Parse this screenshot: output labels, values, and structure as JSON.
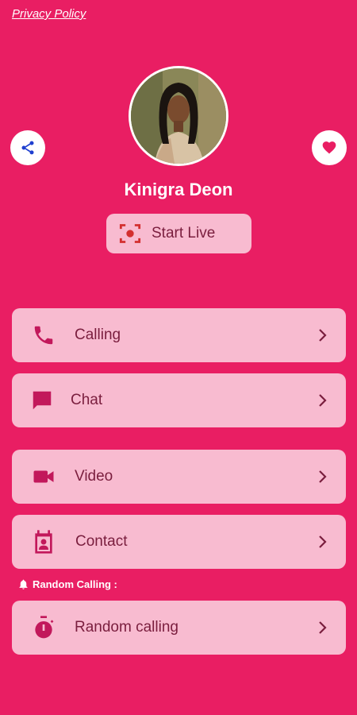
{
  "header": {
    "privacy_link": "Privacy Policy"
  },
  "profile": {
    "name": "Kinigra Deon"
  },
  "live": {
    "label": "Start Live"
  },
  "menu": [
    {
      "label": "Calling",
      "icon": "phone-icon"
    },
    {
      "label": "Chat",
      "icon": "chat-icon"
    },
    {
      "label": "Video",
      "icon": "video-icon"
    },
    {
      "label": "Contact",
      "icon": "contact-icon"
    }
  ],
  "random_section": {
    "title": "Random Calling :",
    "item": {
      "label": "Random calling",
      "icon": "stopwatch-icon"
    }
  },
  "colors": {
    "background": "#e91e63",
    "card": "#f8bbd0",
    "icon": "#c2185b",
    "text": "#7a1e3e"
  }
}
